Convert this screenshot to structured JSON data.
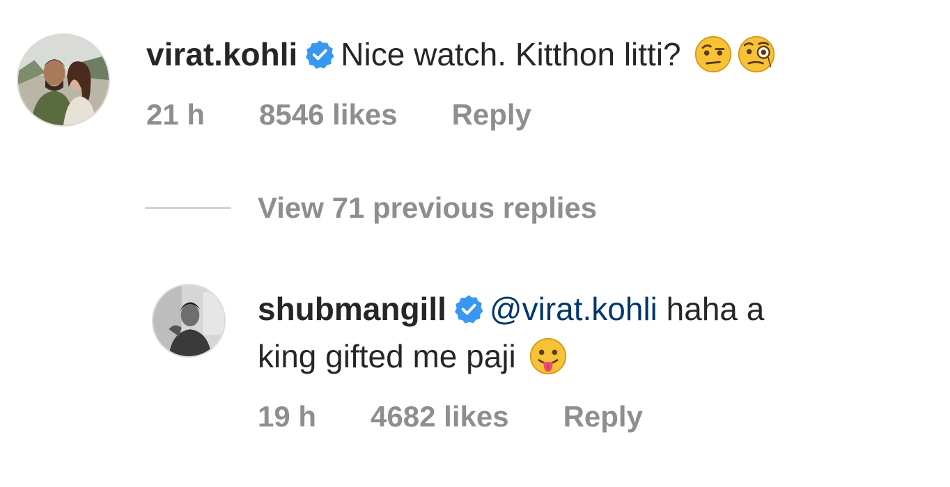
{
  "comments": [
    {
      "username": "virat.kohli",
      "verified": true,
      "text": "Nice watch. Kitthon litti?",
      "emojis": [
        "raised-eyebrow-emoji",
        "monocle-face-emoji"
      ],
      "time": "21 h",
      "likes": "8546 likes",
      "reply_label": "Reply"
    },
    {
      "username": "shubmangill",
      "verified": true,
      "mention": "@virat.kohli",
      "text_line1": "haha a",
      "text_line2": "king gifted me paji",
      "emojis": [
        "tongue-out-emoji"
      ],
      "time": "19 h",
      "likes": "4682 likes",
      "reply_label": "Reply"
    }
  ],
  "view_replies_label": "View 71 previous replies",
  "colors": {
    "verified_badge": "#3897f0",
    "mention": "#00376b",
    "meta_text": "#8e8e8e",
    "primary_text": "#262626"
  }
}
